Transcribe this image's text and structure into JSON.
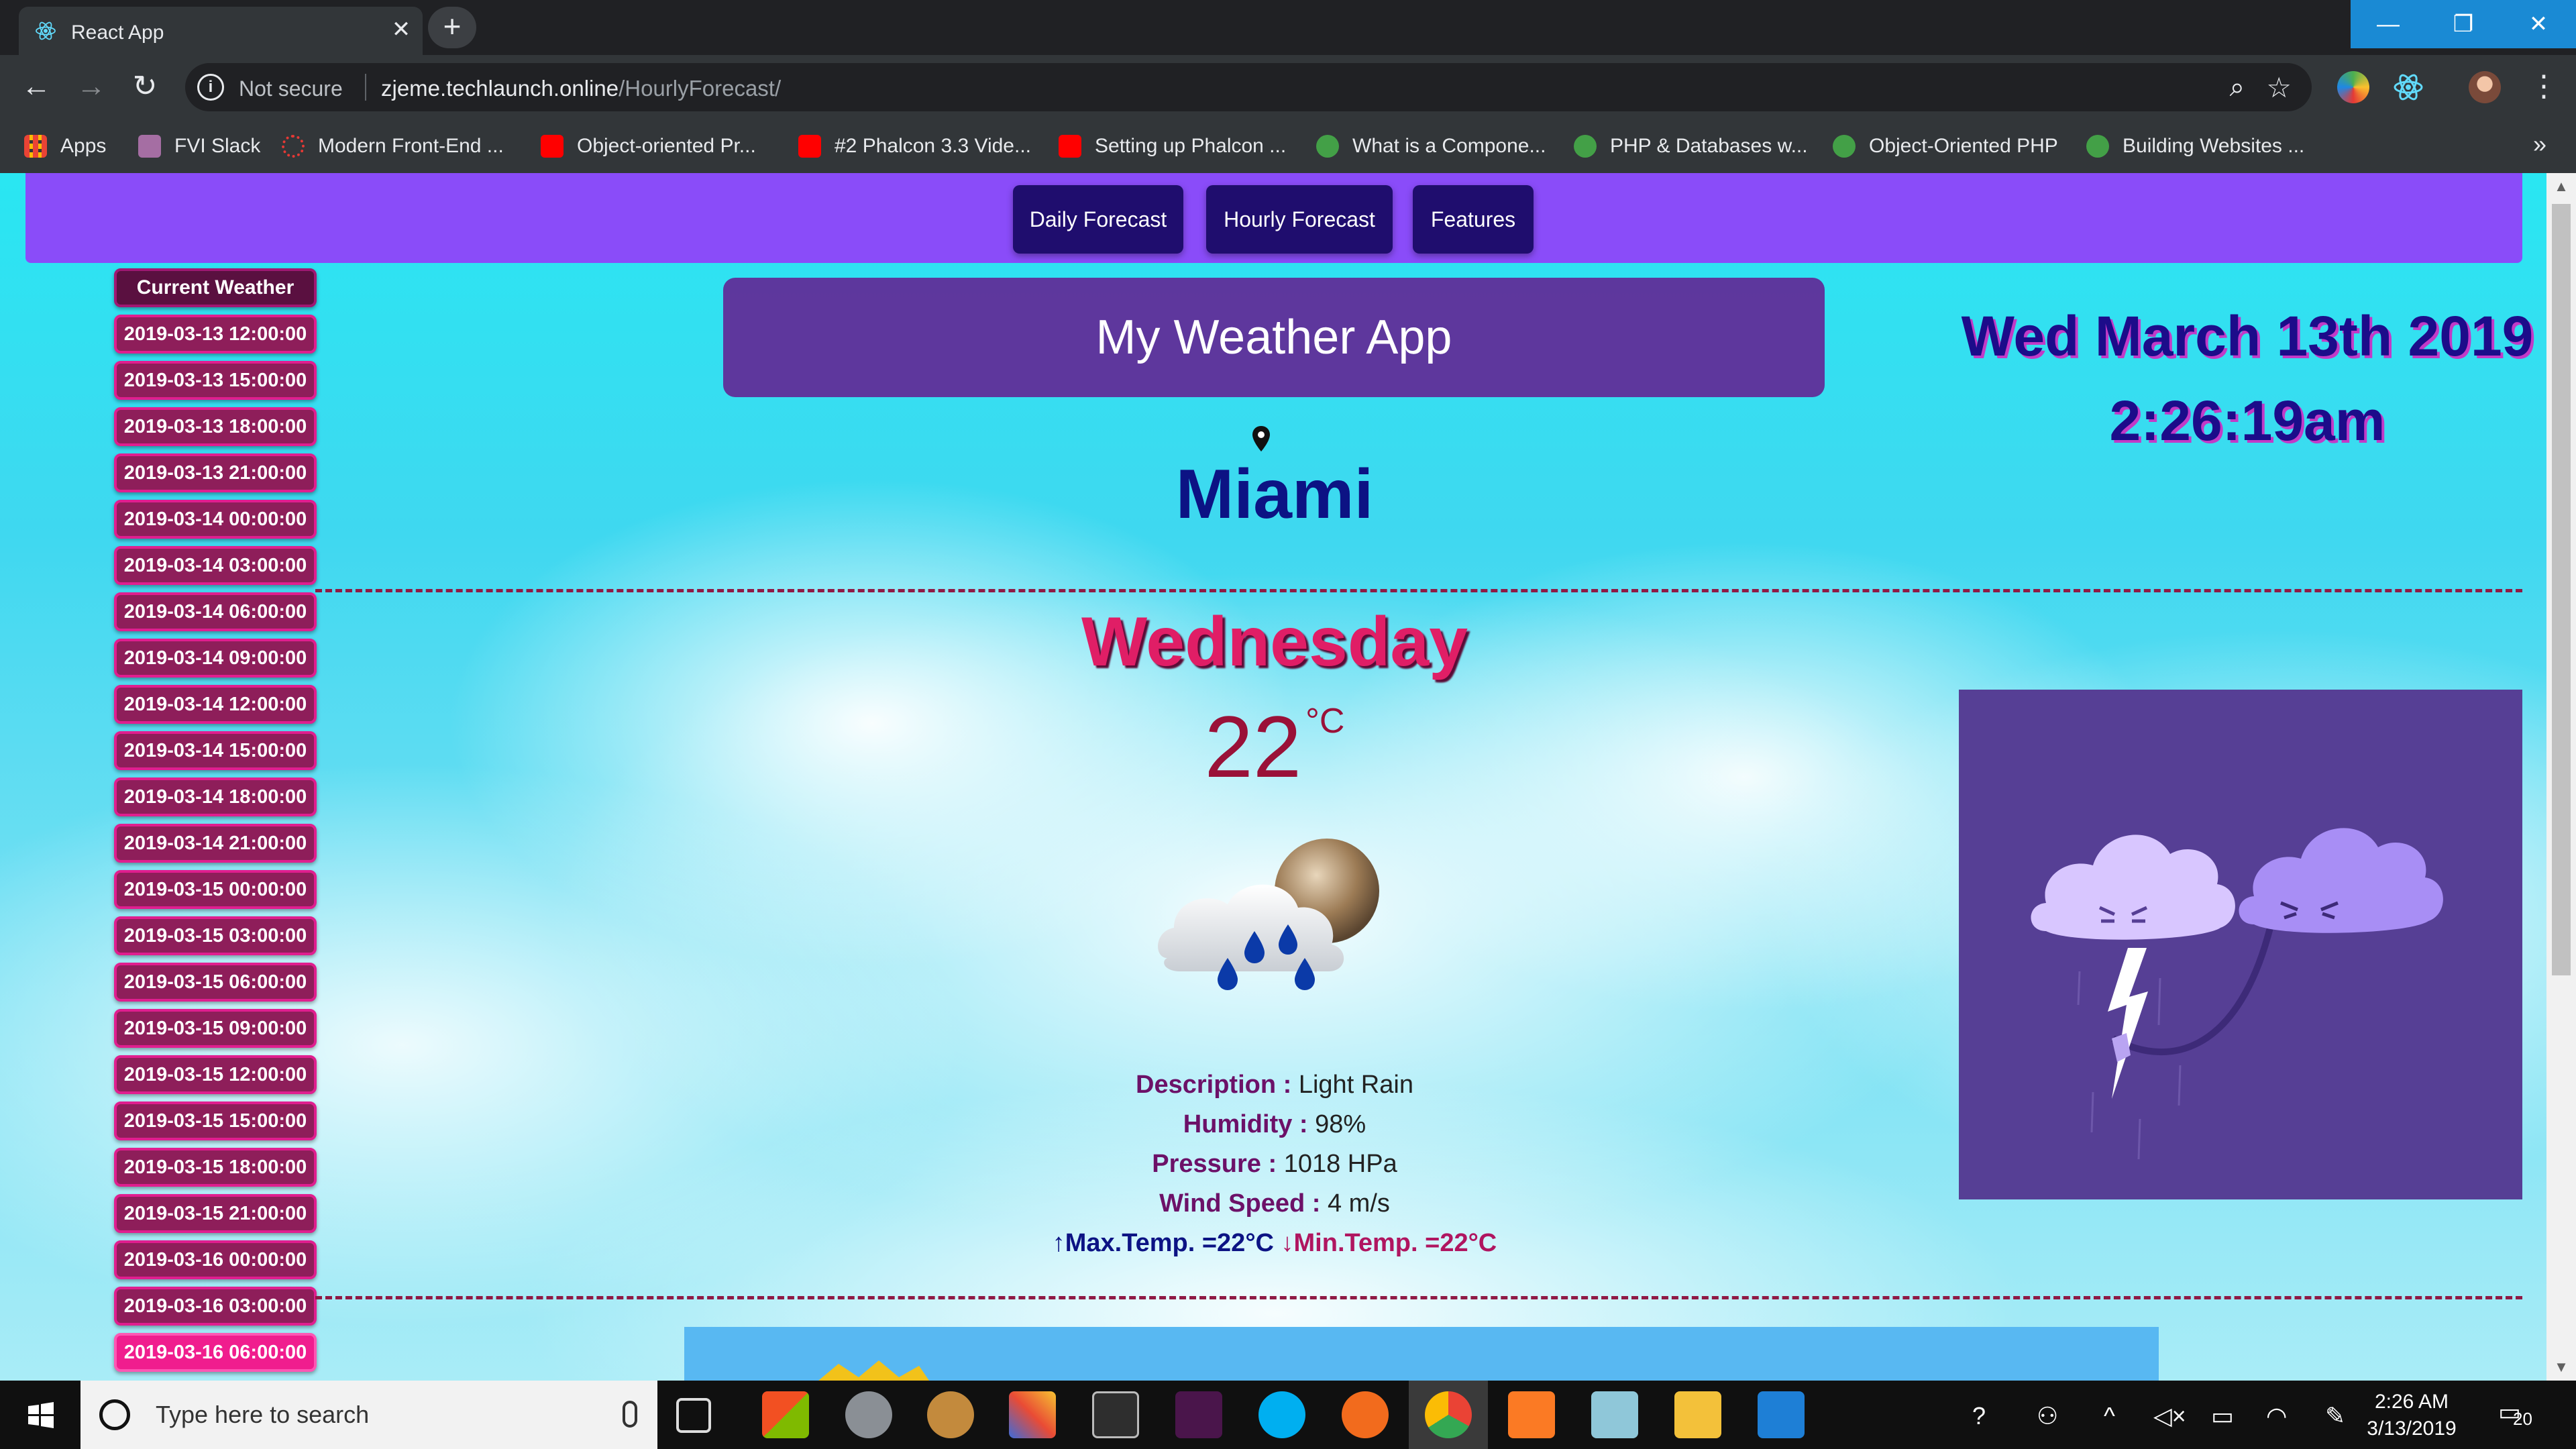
{
  "browser": {
    "tab_title": "React App",
    "tab_close": "✕",
    "new_tab": "+",
    "security_label": "Not secure",
    "url_host": "zjeme.techlaunch.online",
    "url_path": "/HourlyForecast/",
    "bookmarks": [
      {
        "label": "Apps",
        "color": "#f4b400"
      },
      {
        "label": "FVI Slack",
        "color": "#9c27b0"
      },
      {
        "label": "Modern Front-End ...",
        "color": "#e53935"
      },
      {
        "label": "Object-oriented Pr...",
        "color": "#ff0000"
      },
      {
        "label": "#2 Phalcon 3.3 Vide...",
        "color": "#ff0000"
      },
      {
        "label": "Setting up Phalcon ...",
        "color": "#ff0000"
      },
      {
        "label": "What is a Compone...",
        "color": "#2e7d32"
      },
      {
        "label": "PHP & Databases w...",
        "color": "#2e7d32"
      },
      {
        "label": "Object-Oriented PHP",
        "color": "#2e7d32"
      },
      {
        "label": "Building Websites ...",
        "color": "#2e7d32"
      }
    ],
    "bookmarks_more": "»"
  },
  "nav": {
    "buttons": [
      "Daily Forecast",
      "Hourly Forecast",
      "Features"
    ]
  },
  "sidebar": {
    "header": "Current Weather",
    "items": [
      "2019-03-13 12:00:00",
      "2019-03-13 15:00:00",
      "2019-03-13 18:00:00",
      "2019-03-13 21:00:00",
      "2019-03-14 00:00:00",
      "2019-03-14 03:00:00",
      "2019-03-14 06:00:00",
      "2019-03-14 09:00:00",
      "2019-03-14 12:00:00",
      "2019-03-14 15:00:00",
      "2019-03-14 18:00:00",
      "2019-03-14 21:00:00",
      "2019-03-15 00:00:00",
      "2019-03-15 03:00:00",
      "2019-03-15 06:00:00",
      "2019-03-15 09:00:00",
      "2019-03-15 12:00:00",
      "2019-03-15 15:00:00",
      "2019-03-15 18:00:00",
      "2019-03-15 21:00:00",
      "2019-03-16 00:00:00",
      "2019-03-16 03:00:00",
      "2019-03-16 06:00:00"
    ],
    "active_index": 22
  },
  "app": {
    "title": "My Weather App",
    "date": "Wed March 13th 2019",
    "time": "2:26:19am",
    "city": "Miami"
  },
  "weather": {
    "day": "Wednesday",
    "temperature": "22",
    "unit": "°C",
    "icon": "rain-cloud-moon-icon",
    "description_label": "Description :",
    "description": "Light Rain",
    "humidity_label": "Humidity :",
    "humidity": "98%",
    "pressure_label": "Pressure :",
    "pressure": "1018 HPa",
    "wind_label": "Wind Speed :",
    "wind": "4 m/s",
    "max_text": "Max.Temp. =22°C",
    "min_text": "Min.Temp. =22°C"
  },
  "taskbar": {
    "search_placeholder": "Type here to search",
    "clock_time": "2:26 AM",
    "clock_date": "3/13/2019",
    "notifications": "20"
  },
  "colors": {
    "nav_bar": "#8a4cf9",
    "nav_button": "#1f0d6e",
    "sidebar_item": "#8e1e5a",
    "sidebar_active": "#f01d8e",
    "day_name": "#e01e66",
    "city": "#0c1384"
  }
}
